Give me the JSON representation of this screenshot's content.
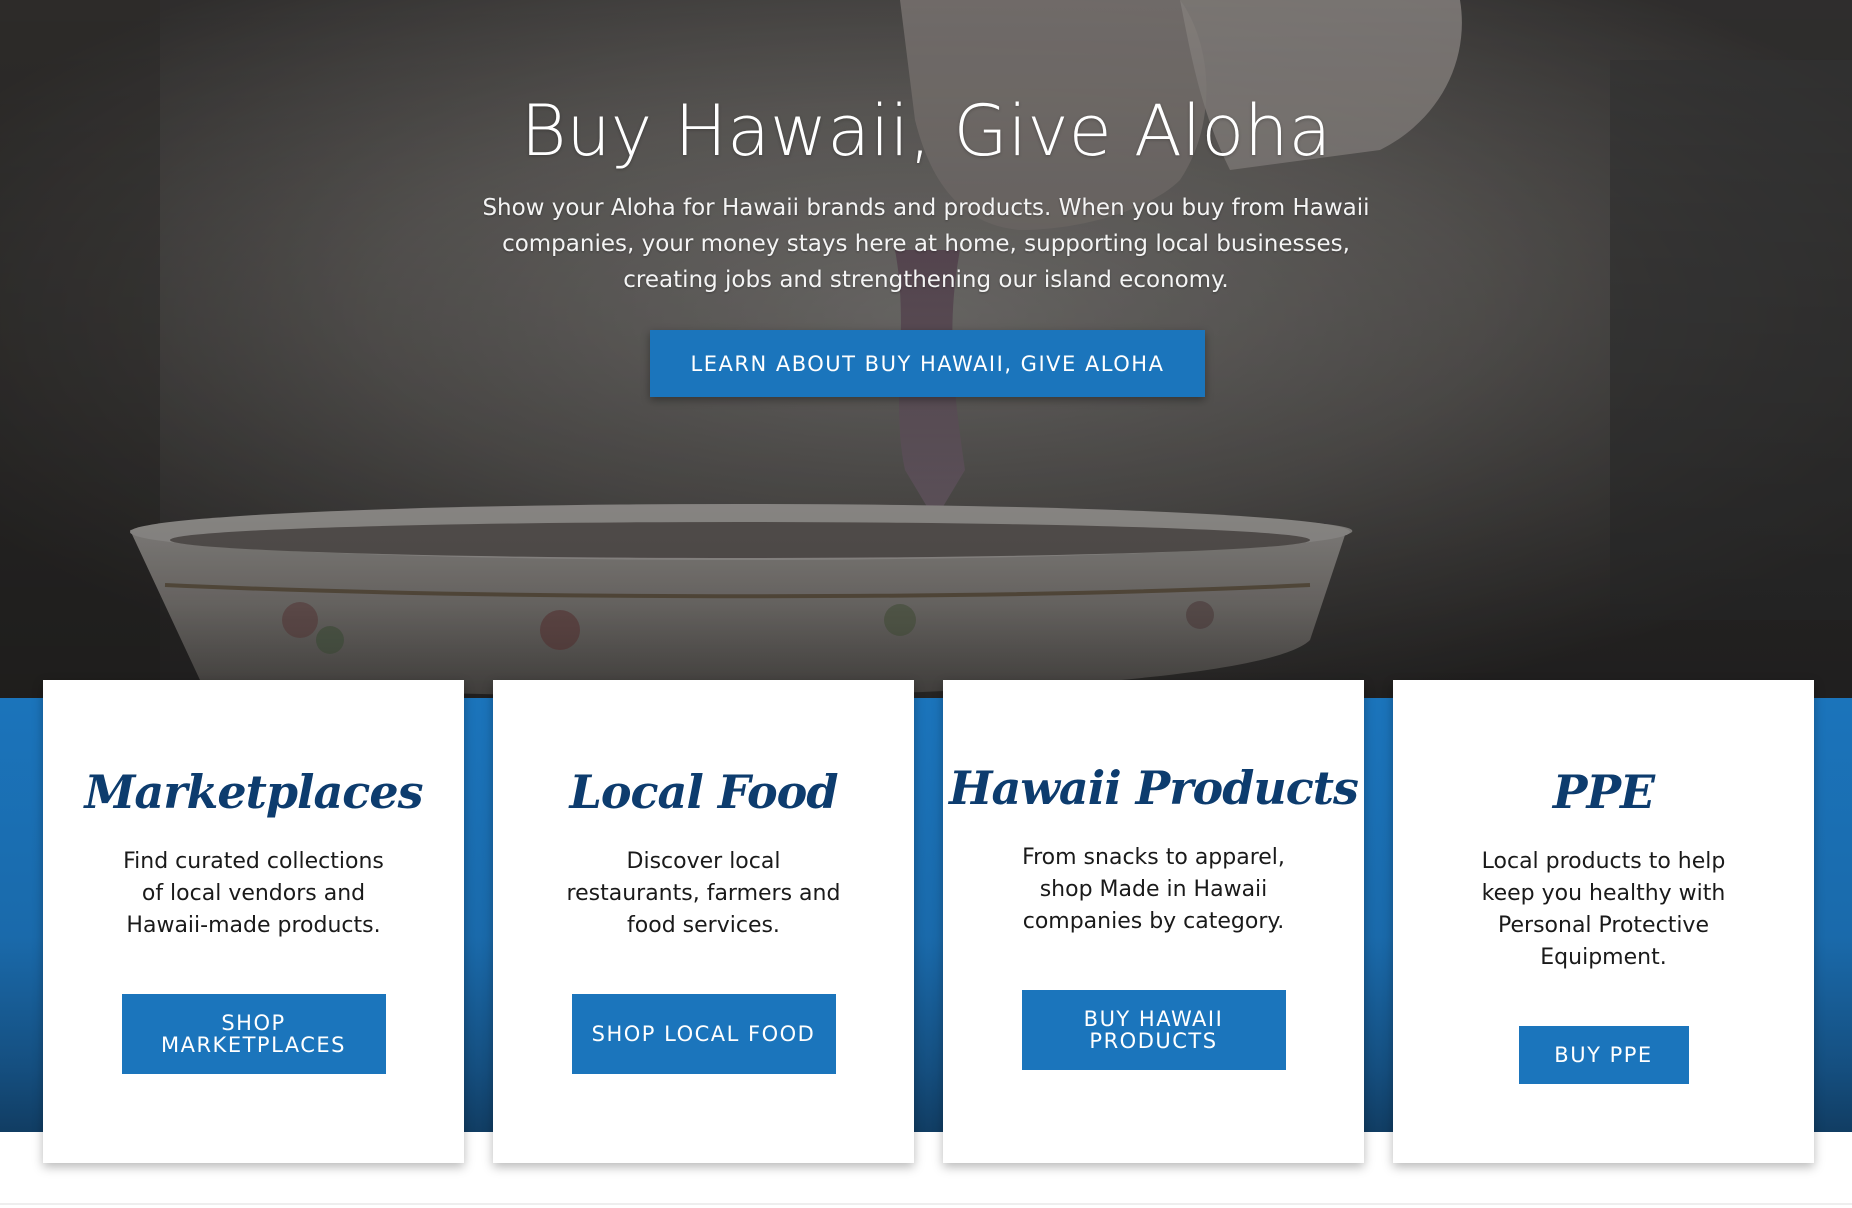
{
  "hero": {
    "title": "Buy Hawaii, Give Aloha",
    "text": "Show your Aloha for Hawaii brands and products. When you buy from Hawaii companies, your money stays here at home, supporting local businesses, creating jobs and strengthening our island economy.",
    "button_label": "LEARN ABOUT BUY HAWAII, GIVE ALOHA"
  },
  "colors": {
    "accent": "#1b75bc",
    "heading": "#0d3c6e",
    "band": "#1b74bb"
  },
  "cards": [
    {
      "title": "Marketplaces",
      "text": "Find curated collections of local vendors and Hawaii-made products.",
      "button_label": "SHOP MARKETPLACES"
    },
    {
      "title": "Local Food",
      "text": "Discover local restaurants, farmers and food services.",
      "button_label": "SHOP LOCAL FOOD"
    },
    {
      "title": "Hawaii Products",
      "text": "From snacks to apparel, shop Made in Hawaii companies by category.",
      "button_label": "BUY HAWAII PRODUCTS"
    },
    {
      "title": "PPE",
      "text": "Local products to help keep you healthy with Personal Protective Equipment.",
      "button_label": "BUY PPE"
    }
  ]
}
